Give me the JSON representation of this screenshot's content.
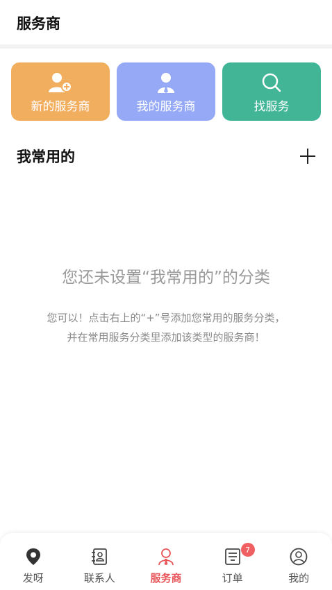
{
  "header": {
    "title": "服务商"
  },
  "actions": [
    {
      "label": "新的服务商",
      "icon": "add-user-icon",
      "color": "#f2ae5f"
    },
    {
      "label": "我的服务商",
      "icon": "user-tie-icon",
      "color": "#96a9f6"
    },
    {
      "label": "找服务",
      "icon": "search-icon",
      "color": "#43b597"
    }
  ],
  "section": {
    "title": "我常用的",
    "add_icon": "plus-icon"
  },
  "empty_state": {
    "main": "您还未设置“我常用的”的分类",
    "hint_line1": "您可以！点击右上的“+”号添加您常用的服务分类，",
    "hint_line2": "并在常用服务分类里添加该类型的服务商！"
  },
  "tabbar": {
    "active_color": "#e8555a",
    "tabs": [
      {
        "label": "发呀",
        "icon": "location-pin-icon"
      },
      {
        "label": "联系人",
        "icon": "contacts-book-icon"
      },
      {
        "label": "服务商",
        "icon": "provider-person-icon",
        "active": true
      },
      {
        "label": "订单",
        "icon": "order-list-icon",
        "badge": "7"
      },
      {
        "label": "我的",
        "icon": "profile-icon"
      }
    ]
  }
}
